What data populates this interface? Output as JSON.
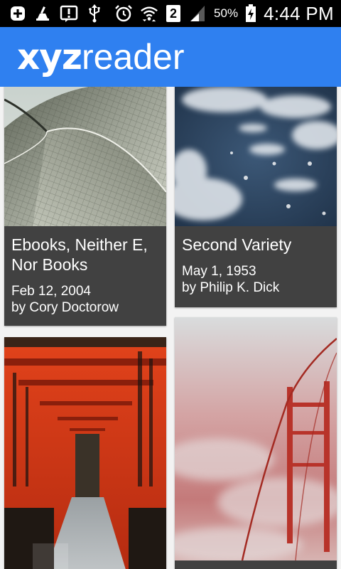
{
  "status_bar": {
    "battery_percent": "50%",
    "time": "4:44 PM",
    "sim_badge": "2",
    "icons": [
      "add-box-icon",
      "cleaner-broom-icon",
      "alert-icon",
      "usb-icon",
      "alarm-clock-icon",
      "wifi-icon",
      "sim-2-icon",
      "signal-icon",
      "battery-charging-icon"
    ]
  },
  "app_bar": {
    "logo_bold": "xyz",
    "logo_light": "reader",
    "background": "#2f80f0"
  },
  "articles": [
    {
      "title_line1": "Ebooks, Neither E,",
      "title_line2": "Nor Books",
      "date": "Feb 12, 2004",
      "author": "by Cory Doctorow",
      "image": "opera-house-roof-photo"
    },
    {
      "title_line1": "Second Variety",
      "title_line2": "",
      "date": "May 1, 1953",
      "author": "by Philip K. Dick",
      "image": "earth-from-space-photo"
    },
    {
      "title_line1": "",
      "title_line2": "",
      "date": "",
      "author": "",
      "image": "torii-gates-photo"
    },
    {
      "title_line1": "",
      "title_line2": "",
      "date": "",
      "author": "",
      "image": "golden-gate-fog-photo"
    }
  ]
}
